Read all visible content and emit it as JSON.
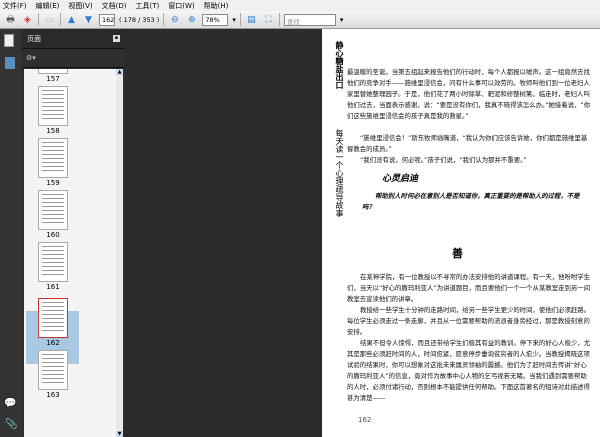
{
  "menu": [
    "文件(F)",
    "编辑(E)",
    "视图(V)",
    "文档(D)",
    "工具(T)",
    "窗口(W)",
    "帮助(H)"
  ],
  "toolbar": {
    "page_input": "162",
    "page_count": "( 178 / 353 )",
    "zoom": "78%",
    "search_placeholder": "查找"
  },
  "panel": {
    "title": "页面"
  },
  "thumbnails": [
    {
      "label": "157"
    },
    {
      "label": "158"
    },
    {
      "label": "159"
    },
    {
      "label": "160"
    },
    {
      "label": "161"
    },
    {
      "label": "162",
      "selected": true
    },
    {
      "label": "163"
    }
  ],
  "page": {
    "side_title": "静心糖盐出口",
    "side_subtitle": "每天读一个心理疏导故事",
    "para1": "最温暖的圣诞。当第五组起来报告他们的行动时，每个人都报以嘘声。这一组竟然去找他们的竞争对手——施维里浸信会，问有什么事可以效劳的。牧师叫他们到一位老妇人家里替她整理园子。于是，他们花了两小时除草、耙泥和修整树篱。临走时，老妇人叫他们过去，当面表示感谢，说：“要是没有你们，我真不晓得该怎么办。”她接着说，“你们这些施维里浸信会的孩子真是我的救星。”",
    "para2": "“施维里浸信会！”斯东牧师插嘴道，“我认为你们应该告诉她，你们都是施维里基督教会的成员。”",
    "para3": "“我们没有说，何必呢。”孩子们说，“我们认为那并不重要。”",
    "insight_title": "心灵启迪",
    "insight": "帮助别人时何必在意别人是否知道你，真正重要的是帮助人的过程，不是吗？",
    "heading": "善",
    "para4": "在某神学院，有一位教授以不寻常的办法安排他的讲道课程。有一天，他吩咐学生们，当天以“好心的撒玛利亚人”为讲道题目，而且要他们一个一个从某教室走到另一间教室去宣读他们的讲章。",
    "para5": "教授给一些学生十分钟的走路时间，给另一些学生更少的时间，使他们必须赶路。每位学生必须走过一条走廊，并且从一位需要帮助的流浪者身旁经过，那是教授刻意的安排。",
    "para6": "结果不但令人惊愕，而且还带给学生们极其有益的教训。停下来的好心人极少，尤其是那些必须赶时间的人，时间愈紧，愿意停步垂询贫穷者的人愈少。当教授揭晓这项试验的结果时，你可以想象对这批未来属灵领袖的震撼。他们为了赶时间去传讲“好心的撒玛利亚人”的信息，竟对作为故事中心人物的乞丐视若无睹。当我们遇到需要帮助的人时，必须付诸行动，否则根本不能提供任何帮助。下面这首著名的短诗对此描述得甚为清楚——",
    "page_number": "162"
  }
}
